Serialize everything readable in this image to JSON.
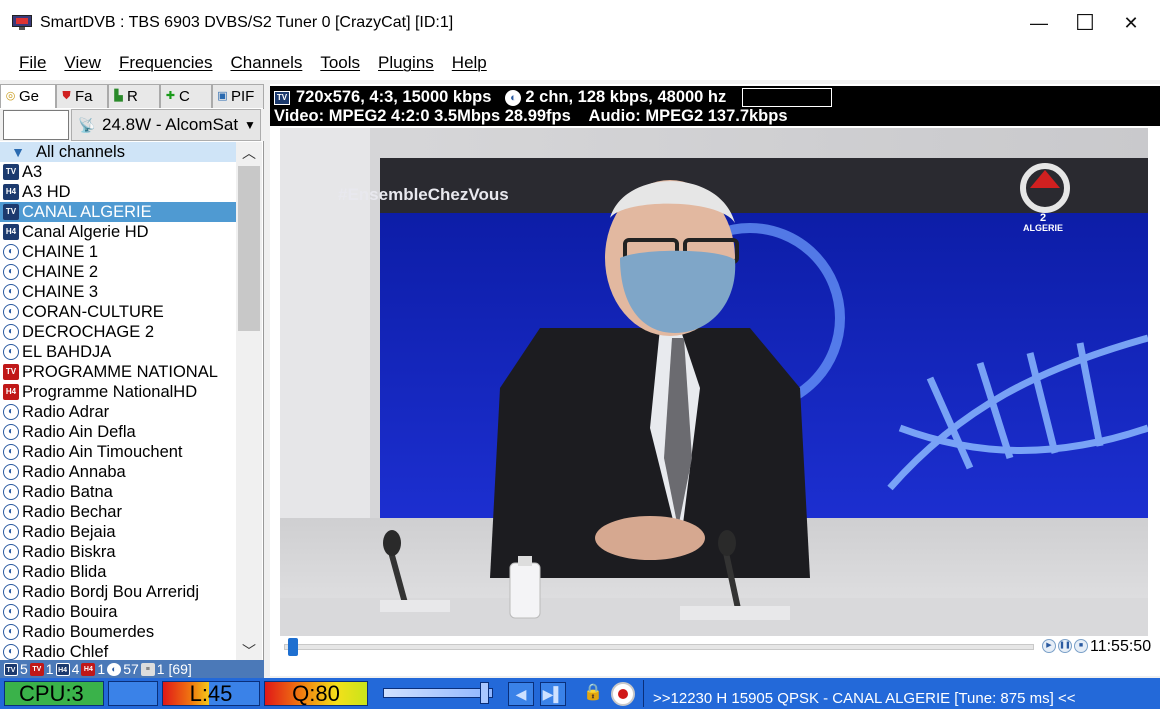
{
  "window": {
    "title": "SmartDVB : TBS 6903 DVBS/S2 Tuner 0 [CrazyCat] [ID:1]",
    "minimize_glyph": "—",
    "maximize_glyph": "☐",
    "close_glyph": "✕"
  },
  "menu": [
    "File",
    "View",
    "Frequencies",
    "Channels",
    "Tools",
    "Plugins",
    "Help"
  ],
  "tabs": [
    {
      "label": "Ge",
      "icon": "globe-icon"
    },
    {
      "label": "Fa",
      "icon": "shield-icon"
    },
    {
      "label": "R",
      "icon": "recorder-icon"
    },
    {
      "label": "C",
      "icon": "plus-icon"
    },
    {
      "label": "PIF",
      "icon": "tv-icon"
    }
  ],
  "satellite": {
    "input_value": "",
    "selected": "24.8W -  AlcomSat"
  },
  "channels": {
    "group_label": "All channels",
    "selected": "CANAL ALGERIE",
    "items": [
      {
        "name": "A3",
        "type": "tv"
      },
      {
        "name": "A3 HD",
        "type": "h4"
      },
      {
        "name": "CANAL ALGERIE",
        "type": "tv"
      },
      {
        "name": "Canal Algerie HD",
        "type": "h4"
      },
      {
        "name": "CHAINE 1",
        "type": "rad"
      },
      {
        "name": "CHAINE 2",
        "type": "rad"
      },
      {
        "name": "CHAINE 3",
        "type": "rad"
      },
      {
        "name": "CORAN-CULTURE",
        "type": "rad"
      },
      {
        "name": "DECROCHAGE 2",
        "type": "rad"
      },
      {
        "name": "EL BAHDJA",
        "type": "rad"
      },
      {
        "name": "PROGRAMME NATIONAL",
        "type": "tvr"
      },
      {
        "name": "Programme NationalHD",
        "type": "h4r"
      },
      {
        "name": "Radio Adrar",
        "type": "rad"
      },
      {
        "name": "Radio Ain Defla",
        "type": "rad"
      },
      {
        "name": "Radio Ain Timouchent",
        "type": "rad"
      },
      {
        "name": "Radio Annaba",
        "type": "rad"
      },
      {
        "name": "Radio Batna",
        "type": "rad"
      },
      {
        "name": "Radio Bechar",
        "type": "rad"
      },
      {
        "name": "Radio Bejaia",
        "type": "rad"
      },
      {
        "name": "Radio Biskra",
        "type": "rad"
      },
      {
        "name": "Radio Blida",
        "type": "rad"
      },
      {
        "name": "Radio Bordj Bou Arreridj",
        "type": "rad"
      },
      {
        "name": "Radio Bouira",
        "type": "rad"
      },
      {
        "name": "Radio Boumerdes",
        "type": "rad"
      },
      {
        "name": "Radio Chlef",
        "type": "rad"
      }
    ]
  },
  "counts": {
    "tv": "5",
    "tv_red": "1",
    "h4": "4",
    "h4_red": "1",
    "radio": "57",
    "other": "1",
    "total": "[69]"
  },
  "stream": {
    "video_format": "720x576, 4:3, 15000 kbps",
    "audio_format": "2 chn, 128 kbps, 48000 hz",
    "video_info": "Video: MPEG2  4:2:0  3.5Mbps  28.99fps",
    "audio_info": "Audio: MPEG2  137.7kbps"
  },
  "video": {
    "hashtag": "#EnsembleChezVous",
    "logo_number": "2",
    "logo_text": "ALGERIE"
  },
  "playback": {
    "clock": "11:55:50",
    "seek_position": 0.01
  },
  "status": {
    "cpu": "CPU:3",
    "level": "L:45",
    "quality": "Q:80",
    "volume": 0.92,
    "tune_text": ">>12230 H 15905 QPSK - CANAL ALGERIE [Tune: 875 ms] <<",
    "lock_icon": "lock-icon",
    "record_icon": "record-icon"
  },
  "colors": {
    "status_bar": "#2369d9",
    "selection": "#4f9ad2",
    "accent": "#1e6fd0"
  }
}
